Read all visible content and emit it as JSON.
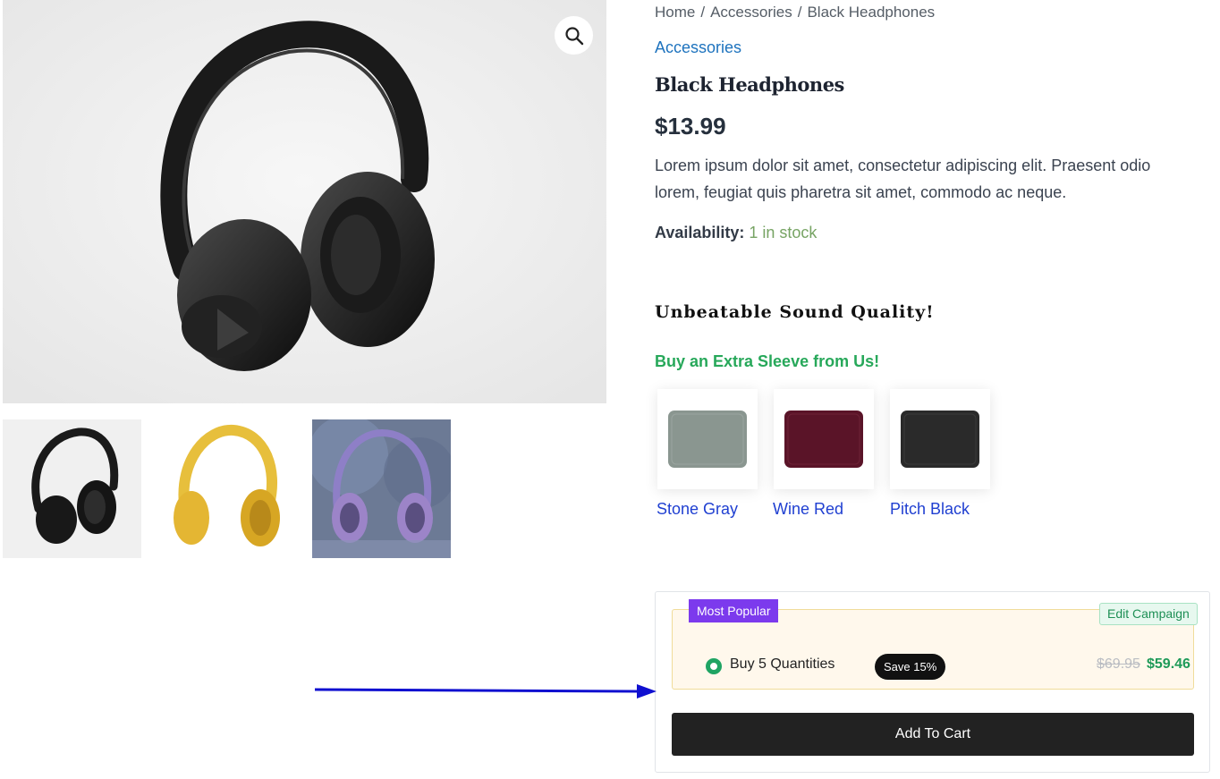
{
  "gallery": {
    "zoom_icon": "magnifier-icon",
    "thumbnails": [
      "black-headphones",
      "yellow-headphones",
      "purple-headphones"
    ]
  },
  "breadcrumb": {
    "items": [
      "Home",
      "Accessories",
      "Black Headphones"
    ],
    "separator": "/"
  },
  "product": {
    "category": "Accessories",
    "title": "Black Headphones",
    "price": "$13.99",
    "description": "Lorem ipsum dolor sit amet, consectetur adipiscing elit. Praesent odio lorem, feugiat quis pharetra sit amet, commodo ac neque.",
    "availability_label": "Availability:",
    "availability_value": "1 in stock"
  },
  "promo": {
    "heading": "Unbeatable Sound Quality!",
    "sleeve_heading": "Buy an Extra Sleeve from Us!",
    "sleeves": [
      {
        "label": "Stone Gray",
        "color": "#8a9690"
      },
      {
        "label": "Wine Red",
        "color": "#5a1428"
      },
      {
        "label": "Pitch Black",
        "color": "#2a2a2a"
      }
    ]
  },
  "campaign": {
    "badge": "Most Popular",
    "edit_label": "Edit Campaign",
    "offer_label": "Buy 5 Quantities",
    "save_badge": "Save 15%",
    "old_price": "$69.95",
    "new_price": "$59.46",
    "add_to_cart": "Add To Cart"
  },
  "colors": {
    "accent_green": "#1fa463",
    "badge_purple": "#7c3aed",
    "link_blue": "#1e73be",
    "arrow_blue": "#1010d0"
  }
}
